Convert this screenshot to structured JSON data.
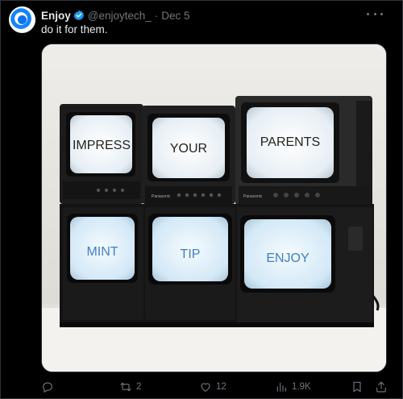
{
  "post": {
    "author_name": "Enjoy",
    "handle": "@enjoytech_",
    "separator": "·",
    "date": "Dec 5",
    "text": "do it for them.",
    "icons": {
      "avatar": "enjoy-logo-avatar",
      "verified": "verified-badge-icon",
      "more": "more-options-icon"
    }
  },
  "media": {
    "screens": [
      "IMPRESS",
      "YOUR",
      "PARENTS",
      "MINT",
      "TIP",
      "ENJOY"
    ],
    "brand_labels": [
      "Panasonic",
      "Panasonic"
    ]
  },
  "actions": {
    "reply_count": "",
    "repost_count": "2",
    "like_count": "12",
    "views_count": "1.9K",
    "icons": [
      "reply-icon",
      "repost-icon",
      "like-icon",
      "views-icon",
      "bookmark-icon",
      "share-icon"
    ]
  },
  "colors": {
    "background": "#000000",
    "text_primary": "#e7e9ea",
    "text_secondary": "#71767b",
    "verified": "#1d9bf0",
    "border": "#2f3336"
  }
}
